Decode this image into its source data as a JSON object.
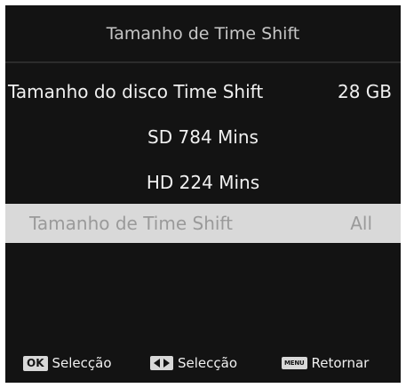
{
  "title": "Tamanho de Time Shift",
  "disk": {
    "label": "Tamanho do disco Time Shift",
    "value": "28 GB"
  },
  "info": {
    "sd": "SD 784 Mins",
    "hd": "HD 224 Mins"
  },
  "selected_row": {
    "label": "Tamanho de Time Shift",
    "value": "All"
  },
  "footer": {
    "ok_key": "OK",
    "ok_label": "Selecção",
    "lr_label": "Selecção",
    "menu_key": "MENU",
    "menu_label": "Retornar"
  },
  "icons": {
    "left_right": "left-right-arrows-icon"
  },
  "colors": {
    "background": "#131313",
    "highlight_row": "#d9d9d9",
    "dim_text": "#9a9a9a"
  }
}
